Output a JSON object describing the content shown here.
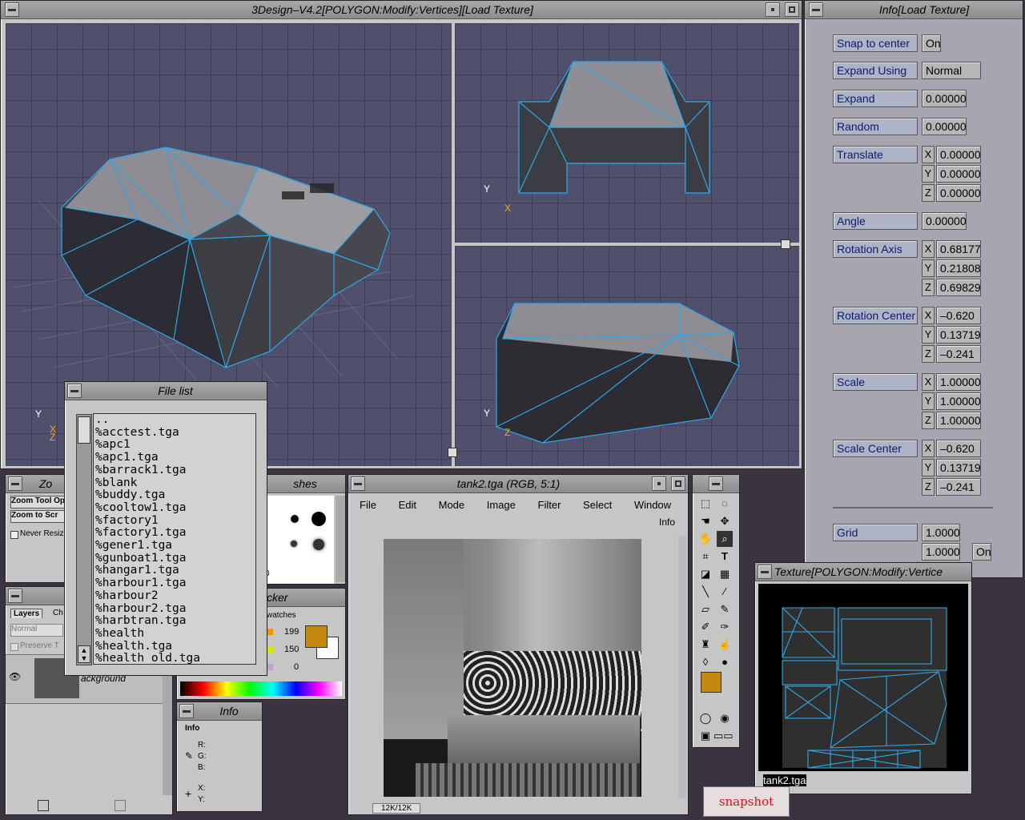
{
  "main_window": {
    "title": "3Design–V4.2[POLYGON:Modify:Vertices][Load Texture]"
  },
  "axes": {
    "y": "Y",
    "x": "X",
    "z": "Z"
  },
  "info_panel": {
    "title": "Info[Load Texture]",
    "snap_to_center": {
      "label": "Snap to center",
      "value": "On"
    },
    "expand_using": {
      "label": "Expand Using",
      "value": "Normal"
    },
    "expand": {
      "label": "Expand",
      "value": "0.00000"
    },
    "random": {
      "label": "Random",
      "value": "0.00000"
    },
    "translate": {
      "label": "Translate",
      "x": "0.00000",
      "y": "0.00000",
      "z": "0.00000"
    },
    "angle": {
      "label": "Angle",
      "value": "0.00000"
    },
    "rotation_axis": {
      "label": "Rotation Axis",
      "x": "0.68177",
      "y": "0.21808",
      "z": "0.69829"
    },
    "rotation_center": {
      "label": "Rotation Center",
      "x": "–0.620",
      "y": "0.13719",
      "z": "–0.241"
    },
    "scale": {
      "label": "Scale",
      "x": "1.00000",
      "y": "1.00000",
      "z": "1.00000"
    },
    "scale_center": {
      "label": "Scale Center",
      "x": "–0.620",
      "y": "0.13719",
      "z": "–0.241"
    },
    "grid": {
      "label": "Grid",
      "value1": "1.0000",
      "value2": "1.0000",
      "toggle": "On"
    }
  },
  "file_list": {
    "title": "File list",
    "files": [
      "..",
      "%acctest.tga",
      "%apc1",
      "%apc1.tga",
      "%barrack1.tga",
      "%blank",
      "%buddy.tga",
      "%cooltow1.tga",
      "%factory1",
      "%factory1.tga",
      "%gener1.tga",
      "%gunboat1.tga",
      "%hangar1.tga",
      "%harbour1.tga",
      "%harbour2",
      "%harbour2.tga",
      "%harbtran.tga",
      "%health",
      "%health.tga",
      "%health_old.tga"
    ]
  },
  "zoom_panel": {
    "title": "Zo",
    "btn1": "Zoom Tool Op",
    "btn2": "Zoom to Scr",
    "never_resize": "Never Resiz"
  },
  "brushes_panel": {
    "title": "shes",
    "size_label": "0"
  },
  "layers_panel": {
    "tab_layers": "Layers",
    "tab_ch": "Ch",
    "mode": "Normal",
    "preserve": "Preserve T",
    "layer_name": "ackground"
  },
  "picker_panel": {
    "title": "cker",
    "tab": "watches",
    "r": "199",
    "g": "150",
    "b": "0"
  },
  "info_small": {
    "title": "Info",
    "tab": "Info",
    "r": "R:",
    "g": "G:",
    "b": "B:",
    "x": "X:",
    "y": "Y:"
  },
  "image_window": {
    "title": "tank2.tga  (RGB, 5:1)",
    "menu": [
      "File",
      "Edit",
      "Mode",
      "Image",
      "Filter",
      "Select",
      "Window"
    ],
    "info_link": "Info",
    "status": "12K/12K"
  },
  "texture_window": {
    "title": "Texture[POLYGON:Modify:Vertice",
    "filename": "tank2.tga"
  },
  "snapshot": {
    "label": "snapshot"
  },
  "colors": {
    "viewport": "#50506d",
    "wire": "#2fa8e8",
    "accent": "#0f1a6a",
    "foreground": "#d49a12"
  }
}
